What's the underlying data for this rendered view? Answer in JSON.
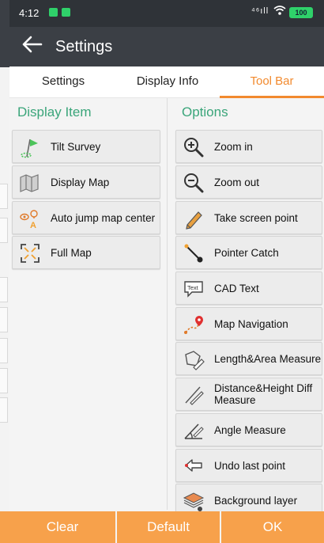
{
  "status": {
    "time": "4:12",
    "signal": "⁴⁶ıll",
    "battery": "100"
  },
  "header": {
    "back_icon": "arrow-left-icon",
    "title": "Settings"
  },
  "tabs": [
    {
      "label": "Settings",
      "active": false
    },
    {
      "label": "Display Info",
      "active": false
    },
    {
      "label": "Tool Bar",
      "active": true
    }
  ],
  "display_item": {
    "title": "Display Item",
    "items": [
      {
        "label": "Tilt Survey",
        "icon": "tilt-survey-icon"
      },
      {
        "label": "Display Map",
        "icon": "map-icon"
      },
      {
        "label": "Auto jump map center",
        "icon": "jump-center-icon"
      },
      {
        "label": "Full Map",
        "icon": "full-map-icon"
      }
    ]
  },
  "options": {
    "title": "Options",
    "items": [
      {
        "label": "Zoom in",
        "icon": "zoom-in-icon"
      },
      {
        "label": "Zoom out",
        "icon": "zoom-out-icon"
      },
      {
        "label": "Take screen point",
        "icon": "pencil-icon"
      },
      {
        "label": "Pointer Catch",
        "icon": "pointer-catch-icon"
      },
      {
        "label": "CAD Text",
        "icon": "cad-text-icon"
      },
      {
        "label": "Map Navigation",
        "icon": "map-navigation-icon"
      },
      {
        "label": "Length&Area Measure",
        "icon": "length-area-icon"
      },
      {
        "label": "Distance&Height Diff Measure",
        "icon": "distance-height-icon"
      },
      {
        "label": "Angle Measure",
        "icon": "angle-icon"
      },
      {
        "label": "Undo last point",
        "icon": "undo-icon"
      },
      {
        "label": "Background layer",
        "icon": "layer-icon"
      }
    ]
  },
  "footer": {
    "clear": "Clear",
    "default": "Default",
    "ok": "OK"
  },
  "colors": {
    "accent": "#f28a2e",
    "header": "#3b3f45",
    "green": "#3aa57a",
    "footer": "#f7a14b"
  }
}
